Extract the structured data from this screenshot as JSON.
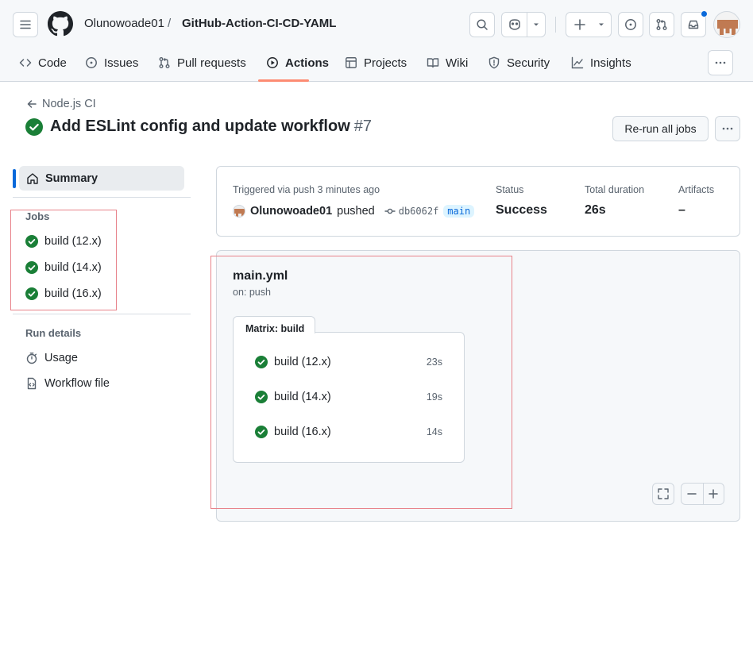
{
  "header": {
    "owner": "Olunowoade01",
    "separator": "/",
    "repo": "GitHub-Action-CI-CD-YAML"
  },
  "tabs": [
    {
      "label": "Code"
    },
    {
      "label": "Issues"
    },
    {
      "label": "Pull requests"
    },
    {
      "label": "Actions"
    },
    {
      "label": "Projects"
    },
    {
      "label": "Wiki"
    },
    {
      "label": "Security"
    },
    {
      "label": "Insights"
    }
  ],
  "run": {
    "back_label": "Node.js CI",
    "title": "Add ESLint config and update workflow",
    "number": "#7",
    "rerun_label": "Re-run all jobs"
  },
  "sidebar": {
    "summary_label": "Summary",
    "jobs_heading": "Jobs",
    "jobs": [
      {
        "label": "build (12.x)"
      },
      {
        "label": "build (14.x)"
      },
      {
        "label": "build (16.x)"
      }
    ],
    "run_details_heading": "Run details",
    "usage_label": "Usage",
    "workflow_file_label": "Workflow file"
  },
  "summary": {
    "trigger_text": "Triggered via push 3 minutes ago",
    "actor": "Olunowoade01",
    "action": "pushed",
    "commit": "db6062f",
    "branch": "main",
    "status_label": "Status",
    "status_value": "Success",
    "duration_label": "Total duration",
    "duration_value": "26s",
    "artifacts_label": "Artifacts",
    "artifacts_value": "–"
  },
  "graph": {
    "workflow_file": "main.yml",
    "trigger": "on: push",
    "matrix_label": "Matrix: build",
    "jobs": [
      {
        "label": "build (12.x)",
        "duration": "23s"
      },
      {
        "label": "build (14.x)",
        "duration": "19s"
      },
      {
        "label": "build (16.x)",
        "duration": "14s"
      }
    ]
  },
  "colors": {
    "success": "#1a7f37",
    "accent": "#0969da",
    "tab_underline": "#fd8c73",
    "annotation_box": "#e8828a"
  }
}
